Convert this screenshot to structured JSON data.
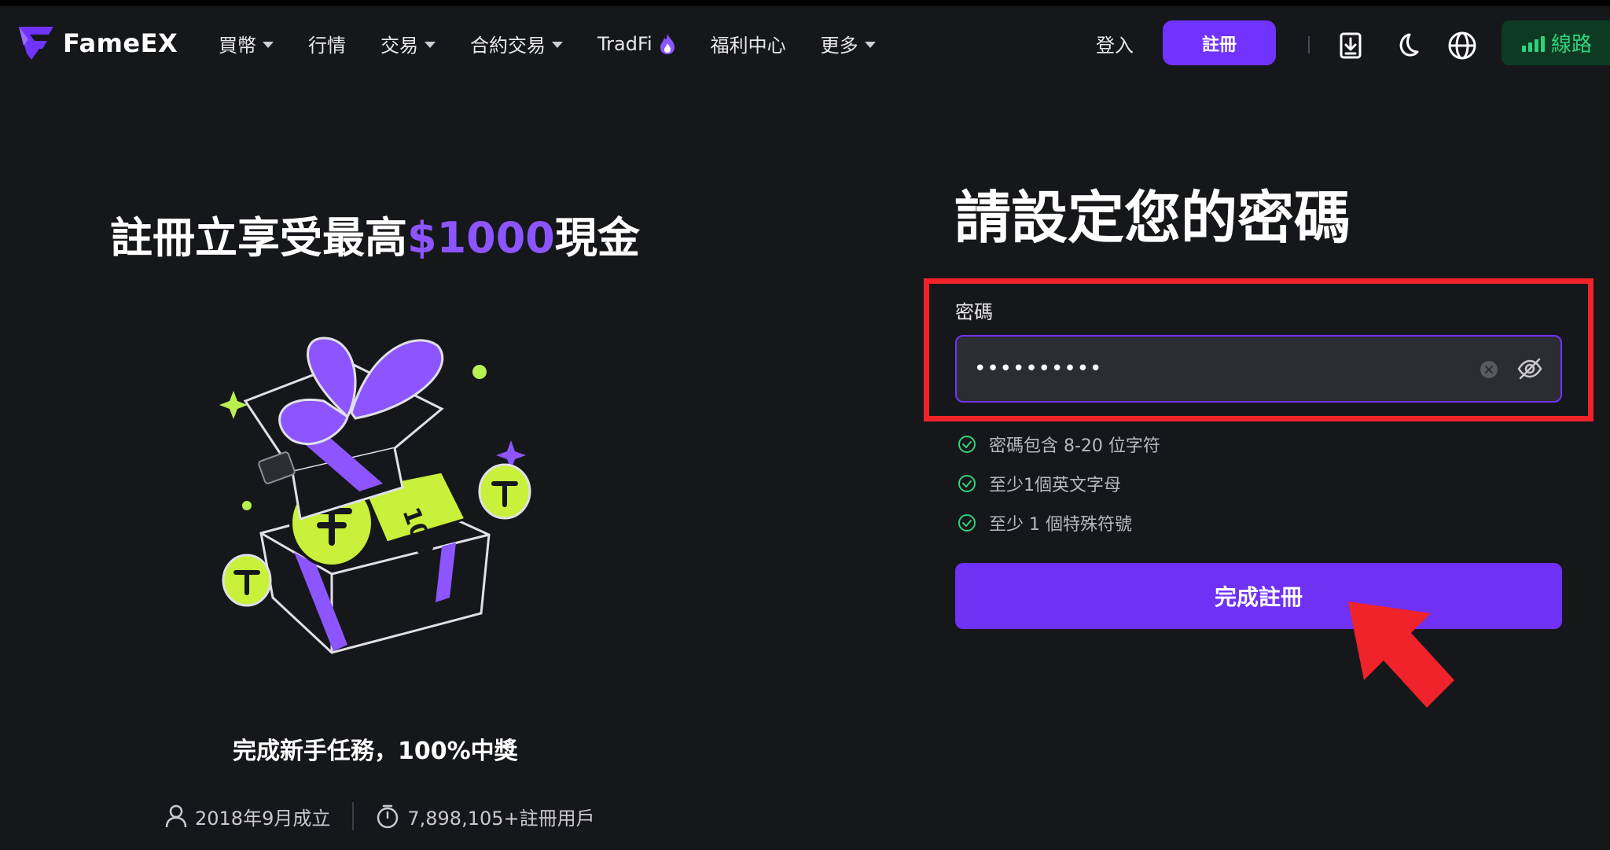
{
  "header": {
    "brand": "FameEX",
    "nav": [
      {
        "label": "買幣",
        "has_caret": true
      },
      {
        "label": "行情",
        "has_caret": false
      },
      {
        "label": "交易",
        "has_caret": true
      },
      {
        "label": "合約交易",
        "has_caret": true
      },
      {
        "label": "TradFi",
        "has_caret": false,
        "icon": "fire-icon"
      },
      {
        "label": "福利中心",
        "has_caret": false
      },
      {
        "label": "更多",
        "has_caret": true
      }
    ],
    "login_label": "登入",
    "signup_label": "註冊",
    "icons": [
      "download-icon",
      "moon-icon",
      "globe-icon"
    ],
    "route_label": "線路"
  },
  "promo": {
    "title_prefix": "註冊立享受最高",
    "title_amount": "$1000",
    "title_suffix": "現金",
    "subtitle": "完成新手任務，100%中獎",
    "stats": [
      {
        "icon": "user-icon",
        "text": "2018年9月成立"
      },
      {
        "icon": "timer-icon",
        "text": "7,898,105+註冊用戶"
      }
    ]
  },
  "form": {
    "title": "請設定您的密碼",
    "password_label": "密碼",
    "password_value": "••••••••••",
    "rules": [
      "密碼包含 8-20 位字符",
      "至少1個英文字母",
      "至少 1 個特殊符號"
    ],
    "submit_label": "完成註冊"
  },
  "colors": {
    "background": "#16171b",
    "accent": "#7133ff",
    "success": "#2fd27a",
    "highlight": "#f0222a"
  }
}
